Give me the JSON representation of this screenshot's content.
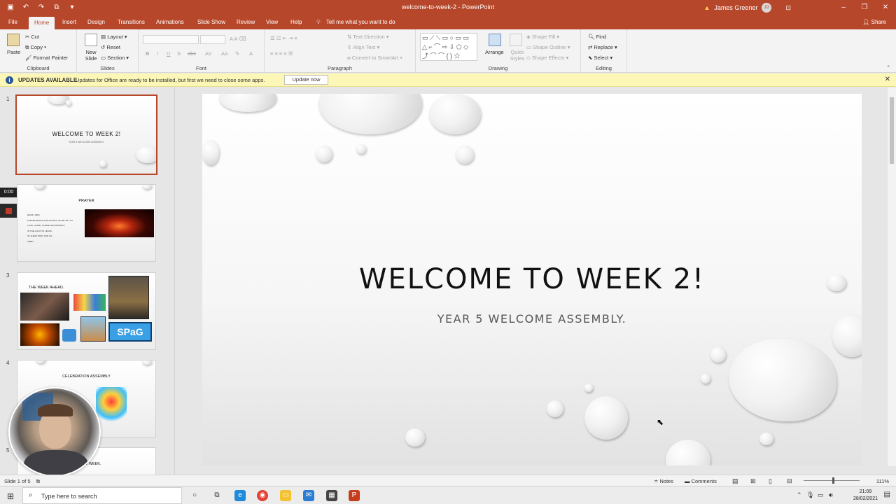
{
  "window": {
    "title": "welcome-to-week-2 - PowerPoint",
    "user_name": "James Greener",
    "user_initials": "JG"
  },
  "tabs": [
    "File",
    "Home",
    "Insert",
    "Design",
    "Transitions",
    "Animations",
    "Slide Show",
    "Review",
    "View",
    "Help"
  ],
  "tell_me": "Tell me what you want to do",
  "share_label": "Share",
  "ribbon": {
    "clipboard": {
      "label": "Clipboard",
      "paste": "Paste",
      "cut": "Cut",
      "copy": "Copy",
      "format_painter": "Format Painter"
    },
    "slides": {
      "label": "Slides",
      "new_slide": "New Slide",
      "layout": "Layout",
      "reset": "Reset",
      "section": "Section"
    },
    "font": {
      "label": "Font"
    },
    "paragraph": {
      "label": "Paragraph",
      "text_direction": "Text Direction",
      "align_text": "Align Text",
      "convert_smartart": "Convert to SmartArt"
    },
    "drawing": {
      "label": "Drawing",
      "arrange": "Arrange",
      "quick_styles": "Quick Styles",
      "shape_fill": "Shape Fill",
      "shape_outline": "Shape Outline",
      "shape_effects": "Shape Effects"
    },
    "editing": {
      "label": "Editing",
      "find": "Find",
      "replace": "Replace",
      "select": "Select"
    }
  },
  "update_bar": {
    "title": "UPDATES AVAILABLE",
    "message": "Updates for Office are ready to be installed, but first we need to close some apps.",
    "button": "Update now"
  },
  "thumbnails": [
    {
      "number": "1",
      "title": "WELCOME TO WEEK 2!",
      "subtitle": "YEAR 5 WELCOME ASSEMBLY."
    },
    {
      "number": "2",
      "title": "PRAYER",
      "lines": [
        "DEAR LORD,",
        "PLEASE BLESS OUR SCHOOL AS WE TRY TO",
        "LOVE, LEARN, SHARE AND RESPECT,",
        "IN THE LIGHT OF JESUS.",
        "ST ALBAN PRAY FOR US.",
        "AMEN."
      ]
    },
    {
      "number": "3",
      "title": "THE WEEK AHEAD.",
      "badge": "SPaG"
    },
    {
      "number": "4",
      "title": "CELEBRATION ASSEMBLY"
    },
    {
      "number": "5",
      "title": "OD WEEK."
    }
  ],
  "recording": {
    "time": "0:00"
  },
  "slide": {
    "title": "WELCOME TO WEEK 2!",
    "subtitle": "YEAR 5 WELCOME ASSEMBLY."
  },
  "status": {
    "slide_of": "Slide 1 of 5",
    "notes": "Notes",
    "comments": "Comments",
    "zoom": "111%"
  },
  "taskbar": {
    "search_placeholder": "Type here to search",
    "time": "21:09",
    "date": "28/02/2021"
  },
  "colors": {
    "accent": "#b7472a",
    "update_bar": "#fcf7b6"
  }
}
